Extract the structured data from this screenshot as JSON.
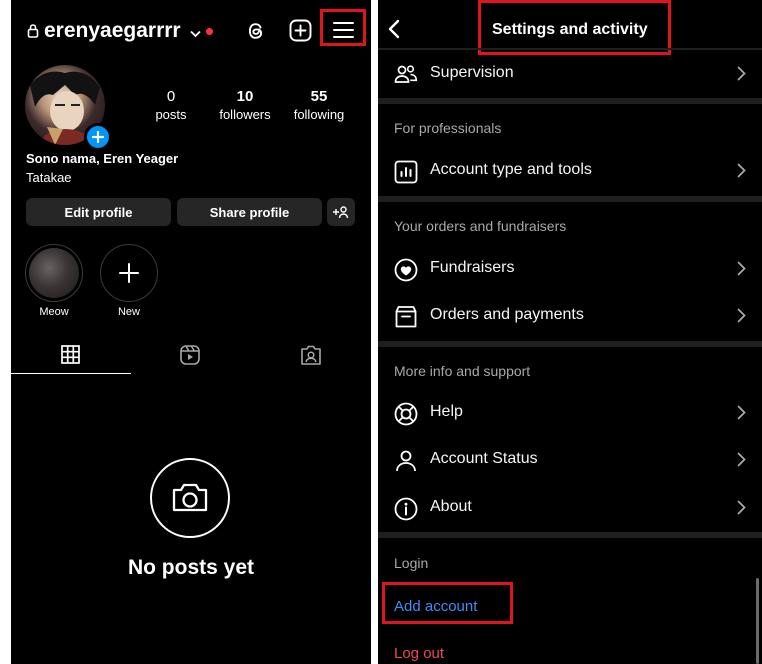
{
  "profile": {
    "username": "erenyaegarrrr",
    "stats": [
      {
        "value": "0",
        "label": "posts"
      },
      {
        "value": "10",
        "label": "followers"
      },
      {
        "value": "55",
        "label": "following"
      }
    ],
    "bio_name": "Sono nama, Eren Yeager",
    "bio_text": "Tatakae",
    "edit_profile_label": "Edit profile",
    "share_profile_label": "Share profile",
    "highlights": [
      {
        "label": "Meow"
      },
      {
        "label": "New"
      }
    ],
    "empty_title": "No posts yet"
  },
  "settings": {
    "title": "Settings and activity",
    "items_top": [
      {
        "label": "Supervision",
        "icon": "supervision-icon"
      }
    ],
    "section_professionals": "For professionals",
    "items_professionals": [
      {
        "label": "Account type and tools",
        "icon": "bar-chart-icon"
      }
    ],
    "section_orders": "Your orders and fundraisers",
    "items_orders": [
      {
        "label": "Fundraisers",
        "icon": "fundraiser-icon"
      },
      {
        "label": "Orders and payments",
        "icon": "orders-icon"
      }
    ],
    "section_support": "More info and support",
    "items_support": [
      {
        "label": "Help",
        "icon": "lifebuoy-icon"
      },
      {
        "label": "Account Status",
        "icon": "person-icon"
      },
      {
        "label": "About",
        "icon": "info-icon"
      }
    ],
    "section_login": "Login",
    "add_account": "Add account",
    "log_out": "Log out"
  },
  "colors": {
    "background": "#000000",
    "highlight_box": "#e0141e",
    "link_blue": "#3e8ef7",
    "logout_red": "#ed4956",
    "button_bg": "#262626"
  }
}
